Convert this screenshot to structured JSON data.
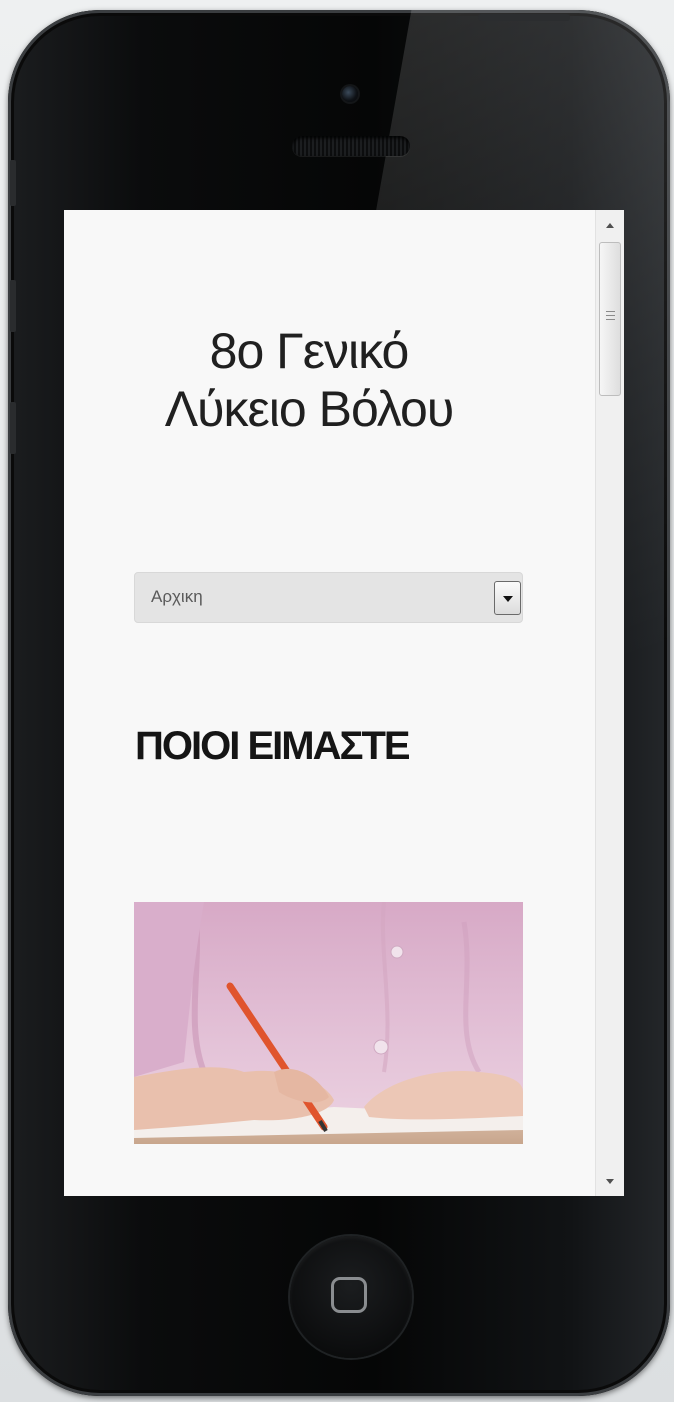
{
  "site": {
    "title_line1": "8ο Γενικό",
    "title_line2": "Λύκειο Βόλου"
  },
  "nav": {
    "selected": "Αρχικη"
  },
  "section": {
    "heading": "ΠΟΙΟΙ ΕΙΜΑΣΤΕ"
  },
  "hero_image": {
    "description_icon": "person-writing-photo"
  },
  "colors": {
    "screen_background": "#f8f8f8",
    "phone_body": "#0b0c0d",
    "select_background": "#e4e4e4"
  }
}
